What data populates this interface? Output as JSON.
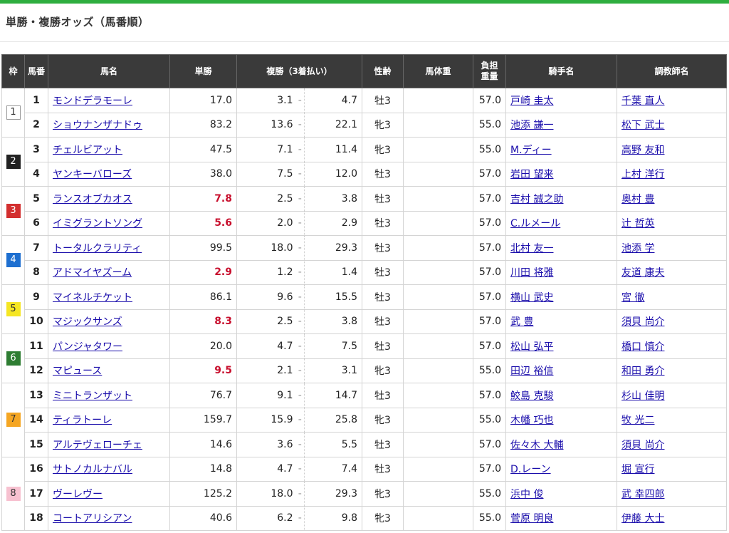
{
  "title": "単勝・複勝オッズ（馬番順）",
  "headers": {
    "waku": "枠",
    "umaban": "馬番",
    "name": "馬名",
    "win": "単勝",
    "place": "複勝（3着払い）",
    "sexage": "性齢",
    "body_weight": "馬体重",
    "burden1": "負担",
    "burden2": "重量",
    "jockey": "騎手名",
    "trainer": "調教師名"
  },
  "waku": [
    {
      "label": "1",
      "bg": "#ffffff",
      "fg": "#333333",
      "rows": 2
    },
    {
      "label": "2",
      "bg": "#222222",
      "fg": "#ffffff",
      "rows": 2
    },
    {
      "label": "3",
      "bg": "#d32f2f",
      "fg": "#ffffff",
      "rows": 2
    },
    {
      "label": "4",
      "bg": "#1e6fd0",
      "fg": "#ffffff",
      "rows": 2
    },
    {
      "label": "5",
      "bg": "#f5e623",
      "fg": "#333333",
      "rows": 2
    },
    {
      "label": "6",
      "bg": "#2e7d32",
      "fg": "#ffffff",
      "rows": 2
    },
    {
      "label": "7",
      "bg": "#f5a623",
      "fg": "#333333",
      "rows": 3
    },
    {
      "label": "8",
      "bg": "#f7c1d0",
      "fg": "#333333",
      "rows": 3
    }
  ],
  "rows": [
    {
      "num": "1",
      "name": "モンドデラモーレ",
      "win": "17.0",
      "hot": false,
      "pmin": "3.1",
      "pmax": "4.7",
      "sex": "牡3",
      "wt": "57.0",
      "jockey": "戸崎 圭太",
      "trainer": "千葉 直人"
    },
    {
      "num": "2",
      "name": "ショウナンザナドゥ",
      "win": "83.2",
      "hot": false,
      "pmin": "13.6",
      "pmax": "22.1",
      "sex": "牝3",
      "wt": "55.0",
      "jockey": "池添 謙一",
      "trainer": "松下 武士"
    },
    {
      "num": "3",
      "name": "チェルビアット",
      "win": "47.5",
      "hot": false,
      "pmin": "7.1",
      "pmax": "11.4",
      "sex": "牝3",
      "wt": "55.0",
      "jockey": "M.ディー",
      "trainer": "高野 友和"
    },
    {
      "num": "4",
      "name": "ヤンキーバローズ",
      "win": "38.0",
      "hot": false,
      "pmin": "7.5",
      "pmax": "12.0",
      "sex": "牡3",
      "wt": "57.0",
      "jockey": "岩田 望来",
      "trainer": "上村 洋行"
    },
    {
      "num": "5",
      "name": "ランスオブカオス",
      "win": "7.8",
      "hot": true,
      "pmin": "2.5",
      "pmax": "3.8",
      "sex": "牡3",
      "wt": "57.0",
      "jockey": "吉村 誠之助",
      "trainer": "奥村 豊"
    },
    {
      "num": "6",
      "name": "イミグラントソング",
      "win": "5.6",
      "hot": true,
      "pmin": "2.0",
      "pmax": "2.9",
      "sex": "牡3",
      "wt": "57.0",
      "jockey": "C.ルメール",
      "trainer": "辻 哲英"
    },
    {
      "num": "7",
      "name": "トータルクラリティ",
      "win": "99.5",
      "hot": false,
      "pmin": "18.0",
      "pmax": "29.3",
      "sex": "牡3",
      "wt": "57.0",
      "jockey": "北村 友一",
      "trainer": "池添 学"
    },
    {
      "num": "8",
      "name": "アドマイヤズーム",
      "win": "2.9",
      "hot": true,
      "pmin": "1.2",
      "pmax": "1.4",
      "sex": "牡3",
      "wt": "57.0",
      "jockey": "川田 将雅",
      "trainer": "友道 康夫"
    },
    {
      "num": "9",
      "name": "マイネルチケット",
      "win": "86.1",
      "hot": false,
      "pmin": "9.6",
      "pmax": "15.5",
      "sex": "牡3",
      "wt": "57.0",
      "jockey": "横山 武史",
      "trainer": "宮 徹"
    },
    {
      "num": "10",
      "name": "マジックサンズ",
      "win": "8.3",
      "hot": true,
      "pmin": "2.5",
      "pmax": "3.8",
      "sex": "牡3",
      "wt": "57.0",
      "jockey": "武 豊",
      "trainer": "須貝 尚介"
    },
    {
      "num": "11",
      "name": "パンジャタワー",
      "win": "20.0",
      "hot": false,
      "pmin": "4.7",
      "pmax": "7.5",
      "sex": "牡3",
      "wt": "57.0",
      "jockey": "松山 弘平",
      "trainer": "橋口 慎介"
    },
    {
      "num": "12",
      "name": "マピュース",
      "win": "9.5",
      "hot": true,
      "pmin": "2.1",
      "pmax": "3.1",
      "sex": "牝3",
      "wt": "55.0",
      "jockey": "田辺 裕信",
      "trainer": "和田 勇介"
    },
    {
      "num": "13",
      "name": "ミニトランザット",
      "win": "76.7",
      "hot": false,
      "pmin": "9.1",
      "pmax": "14.7",
      "sex": "牡3",
      "wt": "57.0",
      "jockey": "鮫島 克駿",
      "trainer": "杉山 佳明"
    },
    {
      "num": "14",
      "name": "ティラトーレ",
      "win": "159.7",
      "hot": false,
      "pmin": "15.9",
      "pmax": "25.8",
      "sex": "牝3",
      "wt": "55.0",
      "jockey": "木幡 巧也",
      "trainer": "牧 光二"
    },
    {
      "num": "15",
      "name": "アルテヴェローチェ",
      "win": "14.6",
      "hot": false,
      "pmin": "3.6",
      "pmax": "5.5",
      "sex": "牡3",
      "wt": "57.0",
      "jockey": "佐々木 大輔",
      "trainer": "須貝 尚介"
    },
    {
      "num": "16",
      "name": "サトノカルナバル",
      "win": "14.8",
      "hot": false,
      "pmin": "4.7",
      "pmax": "7.4",
      "sex": "牡3",
      "wt": "57.0",
      "jockey": "D.レーン",
      "trainer": "堀 宣行"
    },
    {
      "num": "17",
      "name": "ヴーレヴー",
      "win": "125.2",
      "hot": false,
      "pmin": "18.0",
      "pmax": "29.3",
      "sex": "牝3",
      "wt": "55.0",
      "jockey": "浜中 俊",
      "trainer": "武 幸四郎"
    },
    {
      "num": "18",
      "name": "コートアリシアン",
      "win": "40.6",
      "hot": false,
      "pmin": "6.2",
      "pmax": "9.8",
      "sex": "牝3",
      "wt": "55.0",
      "jockey": "菅原 明良",
      "trainer": "伊藤 大士"
    }
  ],
  "separator": "-"
}
